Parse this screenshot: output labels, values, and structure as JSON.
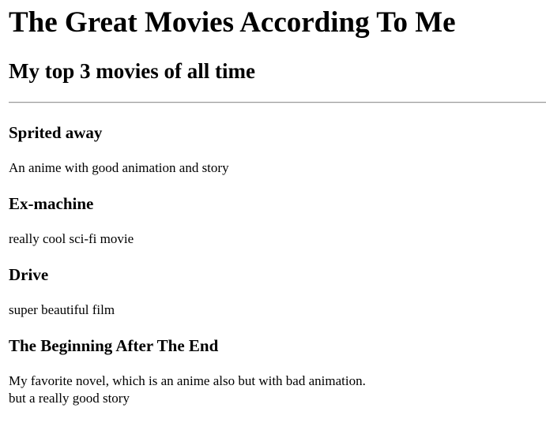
{
  "page": {
    "title": "The Great Movies According To Me",
    "subtitle": "My top 3 movies of all time"
  },
  "movies": [
    {
      "name": "Sprited away",
      "description": "An anime with good animation and story"
    },
    {
      "name": "Ex-machine",
      "description": "really cool sci-fi movie"
    },
    {
      "name": "Drive",
      "description": "super beautiful film"
    },
    {
      "name": "The Beginning After The End",
      "description_line1": "My favorite novel, which is an anime also but with bad animation.",
      "description_line2": "but a really good story"
    }
  ]
}
